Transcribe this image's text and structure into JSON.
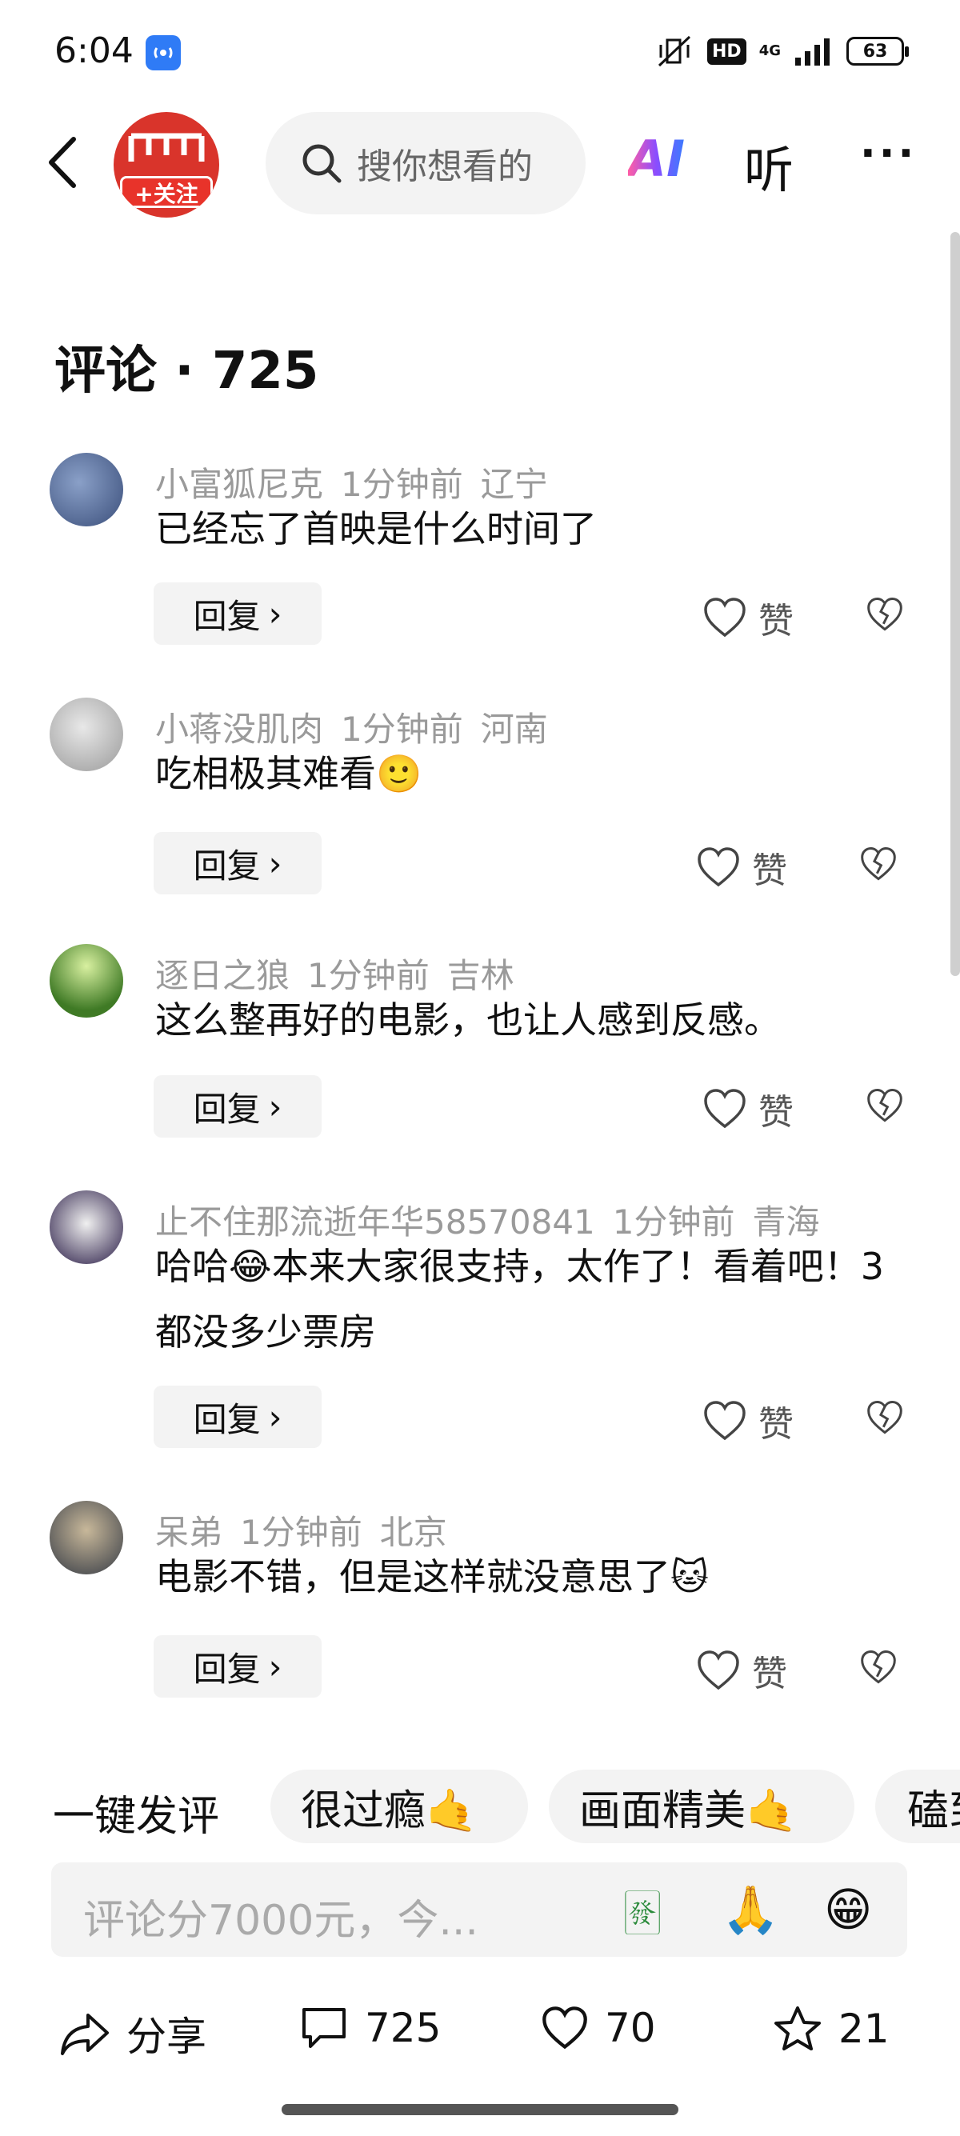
{
  "status": {
    "time": "6:04",
    "network": "4G",
    "hd": "HD",
    "battery": "63"
  },
  "header": {
    "follow_label": "+关注",
    "search_placeholder": "搜你想看的",
    "ai_label": "AI",
    "listen_label": "听",
    "more_label": "···"
  },
  "comments_title": "评论 · 725",
  "comments": [
    {
      "user": "小富狐尼克",
      "time": "1分钟前",
      "location": "辽宁",
      "text": "已经忘了首映是什么时间了",
      "reply": "回复",
      "like": "赞"
    },
    {
      "user": "小蒋没肌肉",
      "time": "1分钟前",
      "location": "河南",
      "text": "吃相极其难看",
      "emoji": "🙂",
      "reply": "回复",
      "like": "赞"
    },
    {
      "user": "逐日之狼",
      "time": "1分钟前",
      "location": "吉林",
      "text": "这么整再好的电影，也让人感到反感。",
      "reply": "回复",
      "like": "赞"
    },
    {
      "user": "止不住那流逝年华58570841",
      "time": "1分钟前",
      "location": "青海",
      "text_a": "哈哈",
      "emoji": "😂",
      "text_b": "本来大家很支持，太作了！看着吧！3都没多少票房",
      "reply": "回复",
      "like": "赞"
    },
    {
      "user": "呆弟",
      "time": "1分钟前",
      "location": "北京",
      "text": "电影不错，但是这样就没意思了",
      "emoji": "🐱",
      "reply": "回复",
      "like": "赞"
    }
  ],
  "quick_comment": {
    "label": "一键发评",
    "chips": [
      "很过瘾🤙",
      "画面精美🤙",
      "磕到"
    ]
  },
  "input": {
    "placeholder": "评论分7000元，今...",
    "emojis": [
      "🀅",
      "🙏",
      "😁"
    ]
  },
  "bottom": {
    "share": "分享",
    "comments": "725",
    "likes": "70",
    "favorites": "21"
  }
}
